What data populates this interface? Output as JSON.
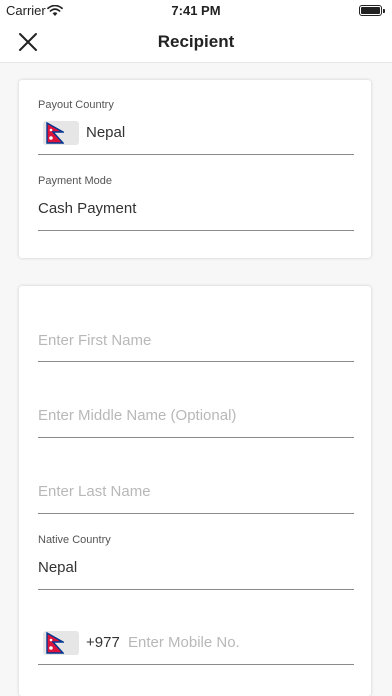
{
  "status": {
    "carrier": "Carrier",
    "time": "7:41 PM"
  },
  "nav": {
    "title": "Recipient"
  },
  "payout": {
    "country_label": "Payout Country",
    "country_value": "Nepal",
    "mode_label": "Payment Mode",
    "mode_value": "Cash Payment"
  },
  "recipient": {
    "first_name_placeholder": "Enter First Name",
    "middle_name_placeholder": "Enter Middle Name (Optional)",
    "last_name_placeholder": "Enter Last Name",
    "native_country_label": "Native Country",
    "native_country_value": "Nepal",
    "dial_code": "+977",
    "mobile_placeholder": "Enter Mobile No."
  },
  "icons": {
    "close": "close-icon",
    "wifi": "wifi-icon",
    "battery": "battery-icon",
    "flag": "nepal-flag-icon"
  },
  "colors": {
    "flag_red": "#DC143C",
    "flag_blue": "#003893",
    "placeholder": "#b8b8b8"
  }
}
